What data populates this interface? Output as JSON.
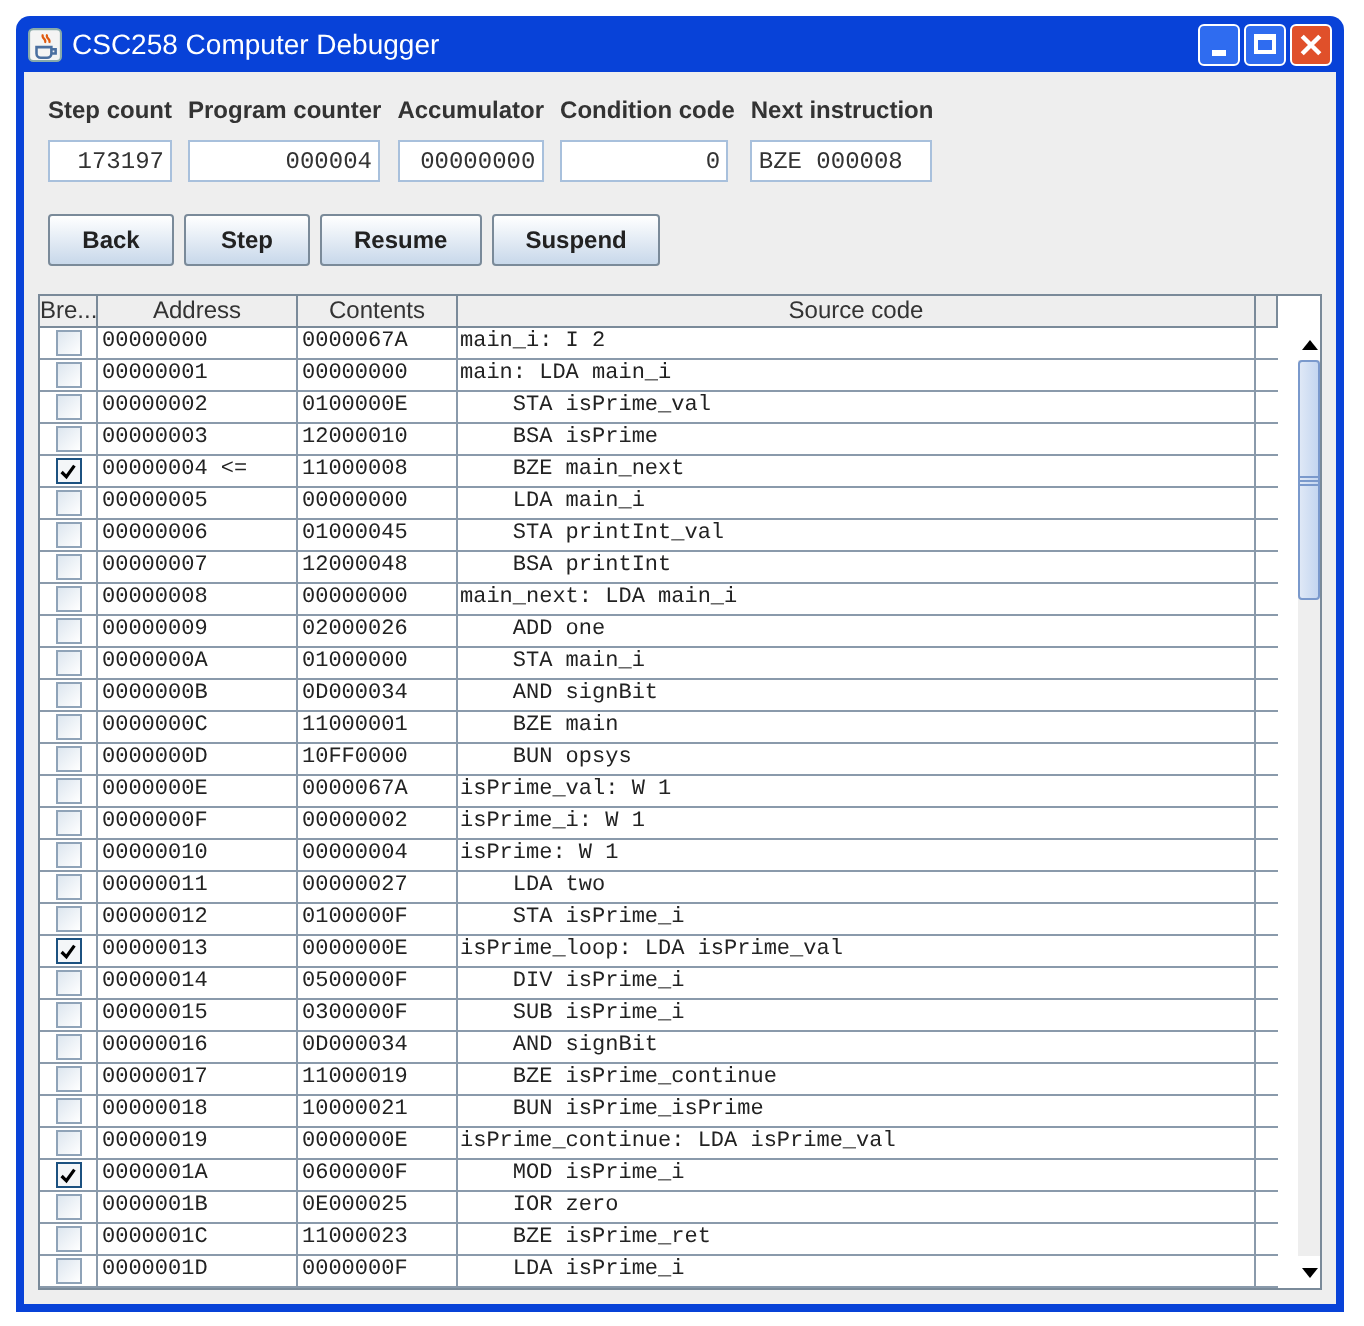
{
  "window": {
    "title": "CSC258 Computer Debugger"
  },
  "registers": [
    {
      "label": "Step count",
      "value": "173197"
    },
    {
      "label": "Program counter",
      "value": "000004"
    },
    {
      "label": "Accumulator",
      "value": "00000000"
    },
    {
      "label": "Condition code",
      "value": "0"
    },
    {
      "label": "Next instruction",
      "value": "BZE 000008"
    }
  ],
  "buttons": [
    "Back",
    "Step",
    "Resume",
    "Suspend"
  ],
  "table": {
    "columns": [
      "Bre...",
      "Address",
      "Contents",
      "Source code"
    ],
    "rows": [
      {
        "breakpoint": false,
        "address": "00000000",
        "contents": "0000067A",
        "source": "main_i: I 2"
      },
      {
        "breakpoint": false,
        "address": "00000001",
        "contents": "00000000",
        "source": "main: LDA main_i"
      },
      {
        "breakpoint": false,
        "address": "00000002",
        "contents": "0100000E",
        "source": "    STA isPrime_val"
      },
      {
        "breakpoint": false,
        "address": "00000003",
        "contents": "12000010",
        "source": "    BSA isPrime"
      },
      {
        "breakpoint": true,
        "address": "00000004",
        "marker": "<=",
        "contents": "11000008",
        "source": "    BZE main_next"
      },
      {
        "breakpoint": false,
        "address": "00000005",
        "contents": "00000000",
        "source": "    LDA main_i"
      },
      {
        "breakpoint": false,
        "address": "00000006",
        "contents": "01000045",
        "source": "    STA printInt_val"
      },
      {
        "breakpoint": false,
        "address": "00000007",
        "contents": "12000048",
        "source": "    BSA printInt"
      },
      {
        "breakpoint": false,
        "address": "00000008",
        "contents": "00000000",
        "source": "main_next: LDA main_i"
      },
      {
        "breakpoint": false,
        "address": "00000009",
        "contents": "02000026",
        "source": "    ADD one"
      },
      {
        "breakpoint": false,
        "address": "0000000A",
        "contents": "01000000",
        "source": "    STA main_i"
      },
      {
        "breakpoint": false,
        "address": "0000000B",
        "contents": "0D000034",
        "source": "    AND signBit"
      },
      {
        "breakpoint": false,
        "address": "0000000C",
        "contents": "11000001",
        "source": "    BZE main"
      },
      {
        "breakpoint": false,
        "address": "0000000D",
        "contents": "10FF0000",
        "source": "    BUN opsys"
      },
      {
        "breakpoint": false,
        "address": "0000000E",
        "contents": "0000067A",
        "source": "isPrime_val: W 1"
      },
      {
        "breakpoint": false,
        "address": "0000000F",
        "contents": "00000002",
        "source": "isPrime_i: W 1"
      },
      {
        "breakpoint": false,
        "address": "00000010",
        "contents": "00000004",
        "source": "isPrime: W 1"
      },
      {
        "breakpoint": false,
        "address": "00000011",
        "contents": "00000027",
        "source": "    LDA two"
      },
      {
        "breakpoint": false,
        "address": "00000012",
        "contents": "0100000F",
        "source": "    STA isPrime_i"
      },
      {
        "breakpoint": true,
        "address": "00000013",
        "contents": "0000000E",
        "source": "isPrime_loop: LDA isPrime_val"
      },
      {
        "breakpoint": false,
        "address": "00000014",
        "contents": "0500000F",
        "source": "    DIV isPrime_i"
      },
      {
        "breakpoint": false,
        "address": "00000015",
        "contents": "0300000F",
        "source": "    SUB isPrime_i"
      },
      {
        "breakpoint": false,
        "address": "00000016",
        "contents": "0D000034",
        "source": "    AND signBit"
      },
      {
        "breakpoint": false,
        "address": "00000017",
        "contents": "11000019",
        "source": "    BZE isPrime_continue"
      },
      {
        "breakpoint": false,
        "address": "00000018",
        "contents": "10000021",
        "source": "    BUN isPrime_isPrime"
      },
      {
        "breakpoint": false,
        "address": "00000019",
        "contents": "0000000E",
        "source": "isPrime_continue: LDA isPrime_val"
      },
      {
        "breakpoint": true,
        "address": "0000001A",
        "contents": "0600000F",
        "source": "    MOD isPrime_i"
      },
      {
        "breakpoint": false,
        "address": "0000001B",
        "contents": "0E000025",
        "source": "    IOR zero"
      },
      {
        "breakpoint": false,
        "address": "0000001C",
        "contents": "11000023",
        "source": "    BZE isPrime_ret"
      },
      {
        "breakpoint": false,
        "address": "0000001D",
        "contents": "0000000F",
        "source": "    LDA isPrime_i"
      }
    ]
  }
}
